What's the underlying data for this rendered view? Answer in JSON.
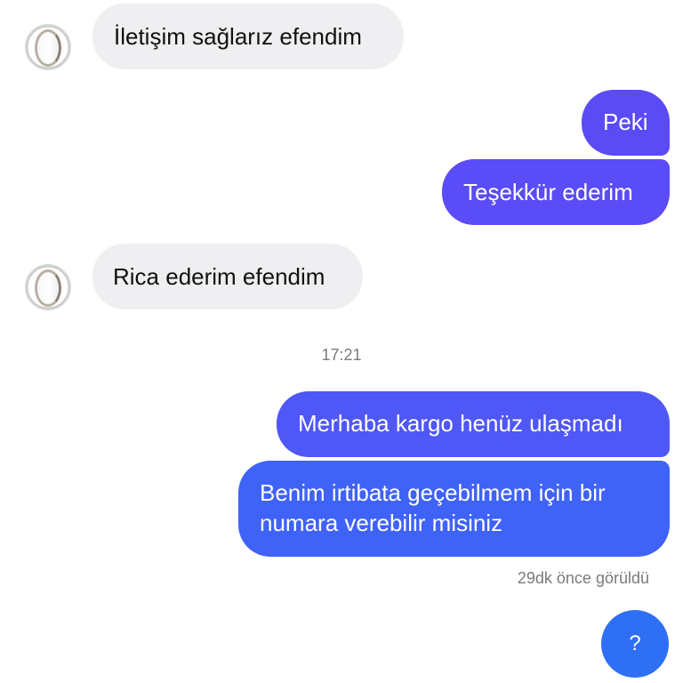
{
  "chat": {
    "messages": [
      {
        "sender": "other",
        "text": "İletişim sağlarız efendim"
      },
      {
        "sender": "me",
        "text": "Peki"
      },
      {
        "sender": "me",
        "text": "Teşekkür ederim"
      },
      {
        "sender": "other",
        "text": "Rica ederim efendim"
      },
      {
        "sender": "me",
        "text": "Merhaba kargo henüz ulaşmadı"
      },
      {
        "sender": "me",
        "lines": [
          "Benim irtibata geçebilmem için bir",
          "numara verebilir misiniz"
        ]
      },
      {
        "sender": "me",
        "text": "?"
      }
    ],
    "timestamp": "17:21",
    "seen_status": "29dk önce görüldü"
  },
  "colors": {
    "incoming_bubble": "#efeff2",
    "outgoing_gradient_top": "#5b4bf5",
    "outgoing_gradient_bottom": "#2f6ff4",
    "meta_text": "#7a7a7a"
  },
  "icons": {
    "avatar": "mirror-avatar-icon"
  }
}
